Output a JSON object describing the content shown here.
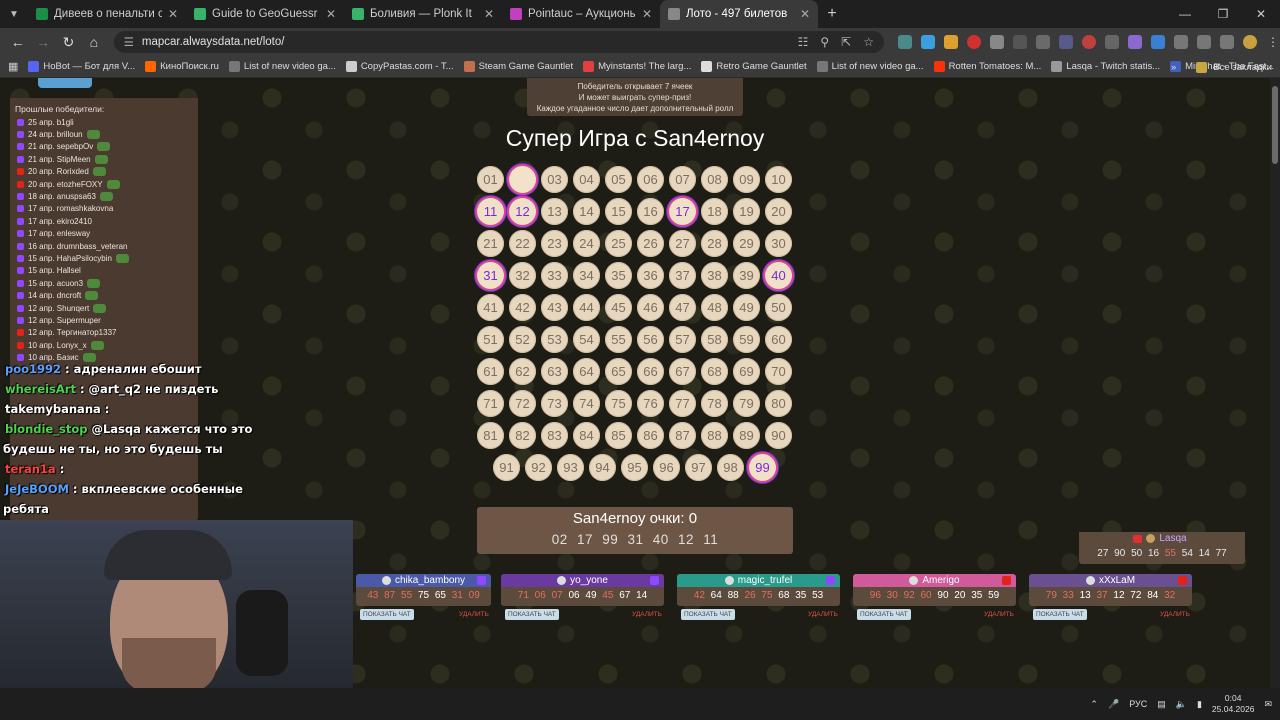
{
  "browser": {
    "tabs": [
      {
        "title": "Дивеев о пенальти с «Локо»:",
        "color": "#1b8f4a",
        "active": false
      },
      {
        "title": "Guide to GeoGuessr — Plonk It",
        "color": "#39b36b",
        "active": false
      },
      {
        "title": "Боливия — Plonk It",
        "color": "#39b36b",
        "active": false
      },
      {
        "title": "Pointauc – Аукционы, лотереи",
        "color": "#c040c0",
        "active": false
      },
      {
        "title": "Лото - 497 билетов",
        "color": "#888888",
        "active": true
      }
    ],
    "url": "mapcar.alwaysdata.net/loto/",
    "bookmarks": [
      {
        "label": "НоBot — Бот для V...",
        "color": "#5865f2"
      },
      {
        "label": "КиноПоиск.ru",
        "color": "#ff6600"
      },
      {
        "label": "List of new video ga...",
        "color": "#777777"
      },
      {
        "label": "CopyPastas.com - T...",
        "color": "#cccccc"
      },
      {
        "label": "Steam Game Gauntlet",
        "color": "#c0704a"
      },
      {
        "label": "Myinstants! The larg...",
        "color": "#e04040"
      },
      {
        "label": "Retro Game Gauntlet",
        "color": "#dddddd"
      },
      {
        "label": "List of new video ga...",
        "color": "#777777"
      },
      {
        "label": "Rotten Tomatoes: M...",
        "color": "#fa320a"
      },
      {
        "label": "Lasqa - Twitch statis...",
        "color": "#999999"
      },
      {
        "label": "Minichat - The Fast...",
        "color": "#4060c0"
      }
    ],
    "all_bookmarks": "Все закладки"
  },
  "info_lines": [
    "Победитель открывает 7 ячеек",
    "И может выиграть супер-приз!",
    "Каждое угаданное число дает дополнительный ролл"
  ],
  "game_title": "Супер Игра с San4ernoy",
  "board": {
    "numbers": [
      "01",
      "02",
      "03",
      "04",
      "05",
      "06",
      "07",
      "08",
      "09",
      "10",
      "11",
      "12",
      "13",
      "14",
      "15",
      "16",
      "17",
      "18",
      "19",
      "20",
      "21",
      "22",
      "23",
      "24",
      "25",
      "26",
      "27",
      "28",
      "29",
      "30",
      "31",
      "32",
      "33",
      "34",
      "35",
      "36",
      "37",
      "38",
      "39",
      "40",
      "41",
      "42",
      "43",
      "44",
      "45",
      "46",
      "47",
      "48",
      "49",
      "50",
      "51",
      "52",
      "53",
      "54",
      "55",
      "56",
      "57",
      "58",
      "59",
      "60",
      "61",
      "62",
      "63",
      "64",
      "65",
      "66",
      "67",
      "68",
      "69",
      "70",
      "71",
      "72",
      "73",
      "74",
      "75",
      "76",
      "77",
      "78",
      "79",
      "80",
      "81",
      "82",
      "83",
      "84",
      "85",
      "86",
      "87",
      "88",
      "89",
      "90",
      "91",
      "92",
      "93",
      "94",
      "95",
      "96",
      "97",
      "98",
      "99"
    ],
    "hits": [
      "11",
      "12",
      "17",
      "31",
      "40",
      "99"
    ],
    "blank": [
      "02"
    ]
  },
  "score": {
    "label": "San4ernoy очки: 0",
    "numbers": "02 17 99 31 40 12 11"
  },
  "winners": {
    "title": "Прошлые победители:",
    "items": [
      {
        "text": "25 апр. b1gli",
        "src": "twitch",
        "emote": false
      },
      {
        "text": "24 апр. brilloun",
        "src": "twitch",
        "emote": true
      },
      {
        "text": "21 апр. sepebpOv",
        "src": "twitch",
        "emote": true
      },
      {
        "text": "21 апр. StipMeen",
        "src": "twitch",
        "emote": true
      },
      {
        "text": "20 апр. Rorixded",
        "src": "yt",
        "emote": true
      },
      {
        "text": "20 апр. etozheFOXY",
        "src": "yt",
        "emote": true
      },
      {
        "text": "18 апр. anuspsa63",
        "src": "twitch",
        "emote": true
      },
      {
        "text": "17 апр. romashkakovna",
        "src": "twitch",
        "emote": false
      },
      {
        "text": "17 апр. ekiro2410",
        "src": "twitch",
        "emote": false
      },
      {
        "text": "17 апр. enlesway",
        "src": "twitch",
        "emote": false
      },
      {
        "text": "16 апр. drumnbass_veteran",
        "src": "twitch",
        "emote": false
      },
      {
        "text": "15 апр. HahaPsilocybin",
        "src": "twitch",
        "emote": true
      },
      {
        "text": "15 апр. Hallsel",
        "src": "twitch",
        "emote": false
      },
      {
        "text": "15 апр. acuon3",
        "src": "twitch",
        "emote": true
      },
      {
        "text": "14 апр. dncroft",
        "src": "twitch",
        "emote": true
      },
      {
        "text": "12 апр. Shunqert",
        "src": "twitch",
        "emote": true
      },
      {
        "text": "12 апр. Supermuper",
        "src": "twitch",
        "emote": false
      },
      {
        "text": "12 апр. Тергинатор1337",
        "src": "yt",
        "emote": false
      },
      {
        "text": "10 апр. Lonyx_x",
        "src": "yt",
        "emote": true
      },
      {
        "text": "10 апр. Базис",
        "src": "twitch",
        "emote": true
      }
    ]
  },
  "chat": [
    {
      "nick": "poo1992",
      "nick_color": "#5aa0ff",
      "text": " : адреналин ебошит"
    },
    {
      "nick": "whereisArt",
      "nick_color": "#4fd24f",
      "text": " : @art_q2 не пиздеть"
    },
    {
      "nick": "takemybanana",
      "nick_color": "#ffffff",
      "text": " : "
    },
    {
      "nick": "blondie_stop",
      "nick_color": "#4fd24f",
      "text": " @Lasqa кажется что это"
    },
    {
      "nick": "",
      "nick_color": "#ffffff",
      "text": "будешь не ты, но это будешь ты"
    },
    {
      "nick": "teran1a",
      "nick_color": "#ff4040",
      "text": " : "
    },
    {
      "nick": "JeJeBOOM",
      "nick_color": "#5aa0ff",
      "text": " : вкплеевские особенные"
    },
    {
      "nick": "",
      "nick_color": "#ffffff",
      "text": "ребята"
    }
  ],
  "players": [
    {
      "name": "chika_bambony",
      "head": "#4a5aa8",
      "nums_dim": "43 87 55",
      "nums": "75 65",
      "nums_dim2": "31 09"
    },
    {
      "name": "yo_yone",
      "head": "#6a3aa0",
      "nums_dim": "71 06 07",
      "nums": "06 49",
      "nums_dim2": "45",
      "nums3": "67 14"
    },
    {
      "name": "magic_trufel",
      "head": "#2a9a8a",
      "nums": "64 88",
      "nums_dim": "42",
      "nums2": "68 35 53",
      "nums_dim2": "26 75"
    },
    {
      "name": "Amerigo",
      "head": "#d05a9a",
      "nums_dim": "96 30 92 60",
      "nums": "90 20 35 59"
    },
    {
      "name": "xXxLaM",
      "head": "#6a5090",
      "nums": "13",
      "nums_dim": "79 33",
      "nums2": "12",
      "nums_dim2": "37",
      "nums3": "72 84",
      "nums_dim3": "32"
    }
  ],
  "lasqa": {
    "name": "Lasqa",
    "nums": "27 90 50 16",
    "dim": "55",
    "nums2": "54 14 77"
  },
  "chat_button": "ПОКАЗАТЬ ЧАТ",
  "delete_button": "УДАЛИТЬ",
  "taskbar": {
    "lang": "РУС",
    "time": "0:04",
    "date": "25.04.2026"
  }
}
